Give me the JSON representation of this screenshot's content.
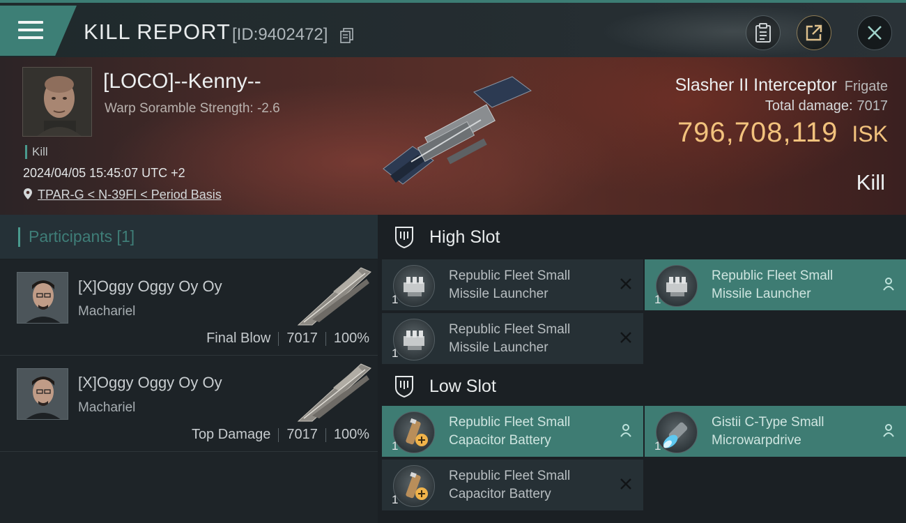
{
  "header": {
    "title": "KILL REPORT",
    "id_label": "[ID:9402472]"
  },
  "victim": {
    "name": "[LOCO]--Kenny--",
    "warp_scramble": "Warp Soramble Strength: -2.6",
    "tag": "Kill",
    "timestamp": "2024/04/05 15:45:07 UTC +2",
    "location": "TPAR-G < N-39FI < Period Basis"
  },
  "ship": {
    "name": "Slasher II Interceptor",
    "class": "Frigate",
    "damage_label": "Total damage:",
    "damage_value": "7017",
    "isk_value": "796,708,119",
    "isk_unit": "ISK",
    "status": "Kill"
  },
  "participants": {
    "header_label": "Participants [1]",
    "rows": [
      {
        "name": "[X]Oggy Oggy Oy Oy",
        "ship": "Machariel",
        "role": "Final Blow",
        "damage": "7017",
        "percent": "100%"
      },
      {
        "name": "[X]Oggy Oggy Oy Oy",
        "ship": "Machariel",
        "role": "Top Damage",
        "damage": "7017",
        "percent": "100%"
      }
    ]
  },
  "slots": {
    "high": {
      "label": "High Slot",
      "modules": [
        {
          "name_line1": "Republic Fleet Small",
          "name_line2": "Missile Launcher",
          "qty": "1",
          "state": "destroyed"
        },
        {
          "name_line1": "Republic Fleet Small",
          "name_line2": "Missile Launcher",
          "qty": "1",
          "state": "dropped"
        },
        {
          "name_line1": "Republic Fleet Small",
          "name_line2": "Missile Launcher",
          "qty": "1",
          "state": "destroyed"
        }
      ]
    },
    "low": {
      "label": "Low Slot",
      "modules": [
        {
          "name_line1": "Republic Fleet Small",
          "name_line2": "Capacitor Battery",
          "qty": "1",
          "state": "dropped"
        },
        {
          "name_line1": "Gistii C-Type Small",
          "name_line2": "Microwarpdrive",
          "qty": "1",
          "state": "dropped"
        },
        {
          "name_line1": "Republic Fleet Small",
          "name_line2": "Capacitor Battery",
          "qty": "1",
          "state": "destroyed"
        }
      ]
    }
  },
  "colors": {
    "accent_teal": "#3d7f76",
    "isk_gold": "#f2c27d",
    "dropped_bg": "#3e7c73"
  },
  "icons": [
    "menu-icon",
    "copy-icon",
    "clipboard-icon",
    "share-icon",
    "close-icon",
    "location-pin-icon",
    "shield-icon",
    "person-icon",
    "x-icon"
  ]
}
